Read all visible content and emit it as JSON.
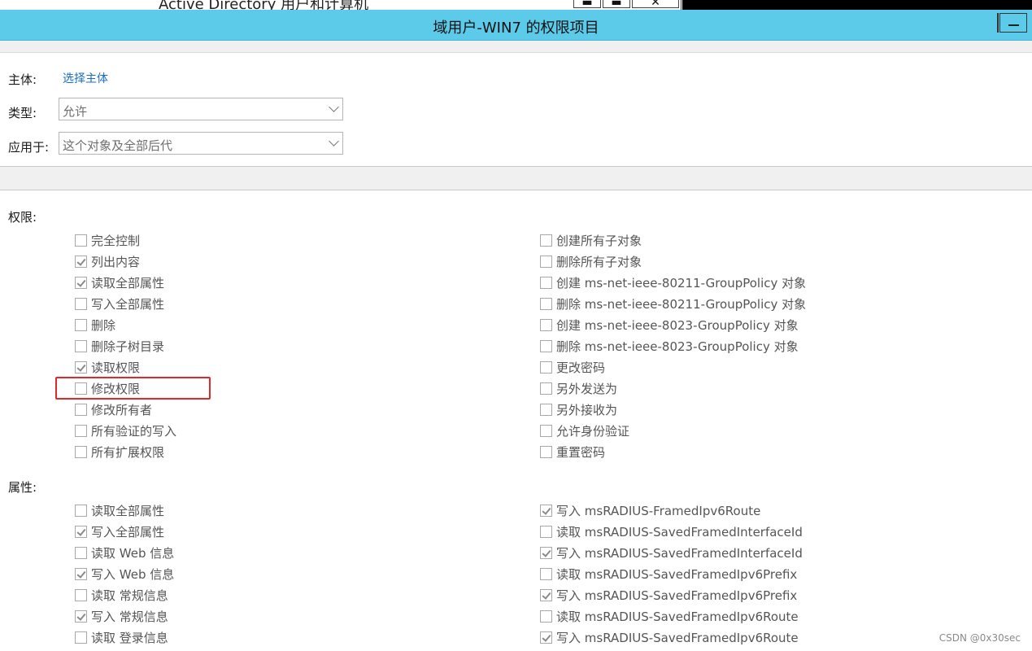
{
  "background_window": {
    "title": "Active Directory 用户和计算机",
    "buttons": [
      "▬",
      "▬",
      "✕"
    ]
  },
  "dialog": {
    "title": "域用户-WIN7 的权限项目",
    "minimize": "—"
  },
  "principal": {
    "label": "主体:",
    "link": "选择主体"
  },
  "type": {
    "label": "类型:",
    "value": "允许"
  },
  "applies_to": {
    "label": "应用于:",
    "value": "这个对象及全部后代"
  },
  "permissions": {
    "heading": "权限:",
    "left": [
      {
        "label": "完全控制",
        "checked": false
      },
      {
        "label": "列出内容",
        "checked": true
      },
      {
        "label": "读取全部属性",
        "checked": true
      },
      {
        "label": "写入全部属性",
        "checked": false
      },
      {
        "label": "删除",
        "checked": false
      },
      {
        "label": "删除子树目录",
        "checked": false
      },
      {
        "label": "读取权限",
        "checked": true
      },
      {
        "label": "修改权限",
        "checked": false
      },
      {
        "label": "修改所有者",
        "checked": false
      },
      {
        "label": "所有验证的写入",
        "checked": false
      },
      {
        "label": "所有扩展权限",
        "checked": false
      }
    ],
    "right": [
      {
        "label": "创建所有子对象",
        "checked": false
      },
      {
        "label": "删除所有子对象",
        "checked": false
      },
      {
        "label": "创建 ms-net-ieee-80211-GroupPolicy 对象",
        "checked": false
      },
      {
        "label": "删除 ms-net-ieee-80211-GroupPolicy 对象",
        "checked": false
      },
      {
        "label": "创建 ms-net-ieee-8023-GroupPolicy 对象",
        "checked": false
      },
      {
        "label": "删除 ms-net-ieee-8023-GroupPolicy 对象",
        "checked": false
      },
      {
        "label": "更改密码",
        "checked": false
      },
      {
        "label": "另外发送为",
        "checked": false
      },
      {
        "label": "另外接收为",
        "checked": false
      },
      {
        "label": "允许身份验证",
        "checked": false
      },
      {
        "label": "重置密码",
        "checked": false
      }
    ]
  },
  "properties": {
    "heading": "属性:",
    "left": [
      {
        "label": "读取全部属性",
        "checked": false
      },
      {
        "label": "写入全部属性",
        "checked": true
      },
      {
        "label": "读取 Web 信息",
        "checked": false
      },
      {
        "label": "写入 Web 信息",
        "checked": true
      },
      {
        "label": "读取 常规信息",
        "checked": false
      },
      {
        "label": "写入 常规信息",
        "checked": true
      },
      {
        "label": "读取 登录信息",
        "checked": false
      }
    ],
    "right": [
      {
        "label": "写入 msRADIUS-FramedIpv6Route",
        "checked": true
      },
      {
        "label": "读取 msRADIUS-SavedFramedInterfaceId",
        "checked": false
      },
      {
        "label": "写入 msRADIUS-SavedFramedInterfaceId",
        "checked": true
      },
      {
        "label": "读取 msRADIUS-SavedFramedIpv6Prefix",
        "checked": false
      },
      {
        "label": "写入 msRADIUS-SavedFramedIpv6Prefix",
        "checked": true
      },
      {
        "label": "读取 msRADIUS-SavedFramedIpv6Route",
        "checked": false
      },
      {
        "label": "写入 msRADIUS-SavedFramedIpv6Route",
        "checked": true
      }
    ]
  },
  "watermark": "CSDN @0x30sec",
  "colors": {
    "titlebar": "#5ccae9",
    "link": "#1a6fc1",
    "highlight_box": "#e02a2a"
  }
}
